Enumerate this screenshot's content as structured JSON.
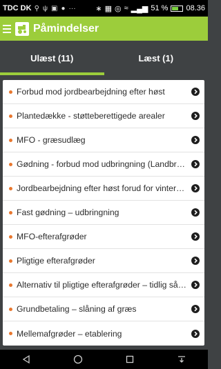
{
  "status_bar": {
    "carrier": "TDC DK",
    "battery_percent_text": "51 %",
    "time": "08.36",
    "battery_level": 0.51
  },
  "app_bar": {
    "title": "Påmindelser"
  },
  "tabs": [
    {
      "label": "Ulæst (11)",
      "active": true
    },
    {
      "label": "Læst (1)",
      "active": false
    }
  ],
  "list": {
    "items": [
      "Forbud mod jordbearbejdning efter høst",
      "Plantedække - støtteberettigede arealer",
      "MFO - græsudlæg",
      "Gødning - forbud mod udbringning (Landbrug)",
      "Jordbearbejdning efter høst forud for vintersæd",
      "Fast gødning – udbringning",
      "MFO-efterafgrøder",
      "Pligtige efterafgrøder",
      "Alternativ til pligtige efterafgrøder – tidlig såning",
      "Grundbetaling – slåning af græs",
      "Mellemafgrøder – etablering"
    ]
  },
  "colors": {
    "accent": "#9ccd3b",
    "bullet": "#e8772e",
    "tab_bg": "#3f4244"
  }
}
